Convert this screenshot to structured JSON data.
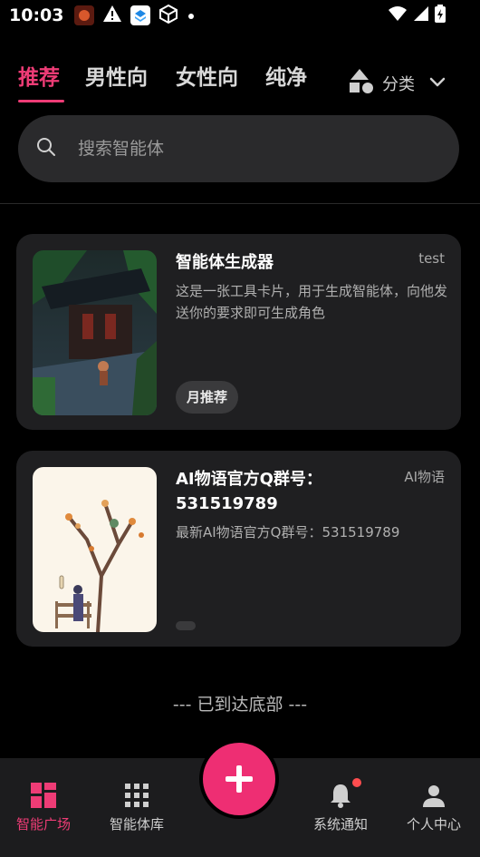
{
  "status_bar": {
    "time": "10:03"
  },
  "tabs": {
    "items": [
      {
        "label": "推荐",
        "active": true
      },
      {
        "label": "男性向",
        "active": false
      },
      {
        "label": "女性向",
        "active": false
      },
      {
        "label": "纯净",
        "active": false
      }
    ],
    "category_label": "分类"
  },
  "search": {
    "placeholder": "搜索智能体",
    "value": ""
  },
  "cards": [
    {
      "title": "智能体生成器",
      "author": "test",
      "description": "这是一张工具卡片，用于生成智能体，向他发送你的要求即可生成角色",
      "tag": "月推荐"
    },
    {
      "title": "AI物语官方Q群号：531519789",
      "author": "AI物语",
      "description": "最新AI物语官方Q群号：531519789",
      "tag": ""
    }
  ],
  "end_note": "--- 已到达底部 ---",
  "bottom_nav": {
    "items": [
      {
        "label": "智能广场",
        "icon": "grid-squares-icon",
        "active": true
      },
      {
        "label": "智能体库",
        "icon": "apps-grid-icon",
        "active": false
      },
      {
        "label": "系统通知",
        "icon": "bell-icon",
        "active": false
      },
      {
        "label": "个人中心",
        "icon": "person-icon",
        "active": false
      }
    ],
    "fab_label": "+"
  },
  "colors": {
    "accent": "#ee3c76",
    "background": "#000000",
    "card": "#1f1f21"
  }
}
